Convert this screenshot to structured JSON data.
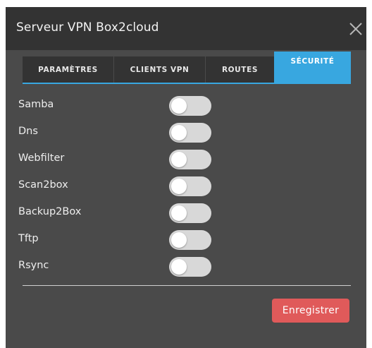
{
  "window": {
    "title": "Serveur VPN Box2cloud",
    "close_icon": "close-icon"
  },
  "tabs": [
    {
      "label": "PARAMÈTRES",
      "active": false
    },
    {
      "label": "CLIENTS VPN",
      "active": false
    },
    {
      "label": "ROUTES",
      "active": false
    },
    {
      "label": "SÉCURITÉ",
      "active": true
    }
  ],
  "settings": [
    {
      "label": "Samba",
      "enabled": false
    },
    {
      "label": "Dns",
      "enabled": false
    },
    {
      "label": "Webfilter",
      "enabled": false
    },
    {
      "label": "Scan2box",
      "enabled": false
    },
    {
      "label": "Backup2Box",
      "enabled": false
    },
    {
      "label": "Tftp",
      "enabled": false
    },
    {
      "label": "Rsync",
      "enabled": false
    }
  ],
  "footer": {
    "save_label": "Enregistrer"
  },
  "colors": {
    "accent": "#38a7e0",
    "save_button": "#e05a5a",
    "panel_bg": "#4a4a4a",
    "header_bg": "#333333",
    "toggle_off": "#d8d8d8"
  }
}
